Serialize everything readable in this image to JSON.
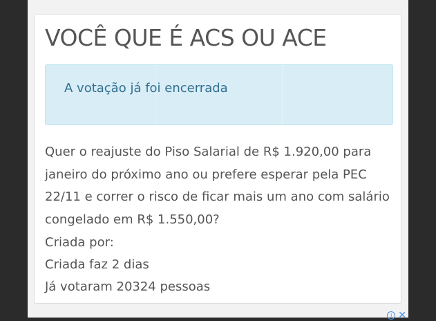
{
  "poll": {
    "title": "VOCÊ QUE É ACS OU ACE",
    "alert_message": "A votação já foi encerrada",
    "question": "Quer o reajuste do Piso Salarial de R$ 1.920,00 para janeiro do próximo ano ou prefere esperar pela PEC 22/11 e correr o risco de ficar mais um ano com salário congelado em R$ 1.550,00?",
    "created_by": "Criada por:",
    "created_ago": "Criada faz 2 dias",
    "votes_text": "Já votaram 20324 pessoas"
  },
  "ad": {
    "info_icon": "info-icon",
    "close_icon": "close-icon"
  },
  "colors": {
    "background_dark": "#2b2b2b",
    "alert_bg": "#d9edf7",
    "alert_border": "#bce8f1",
    "alert_text": "#31708f",
    "text": "#555555",
    "ad_icon": "#4a90e2"
  }
}
